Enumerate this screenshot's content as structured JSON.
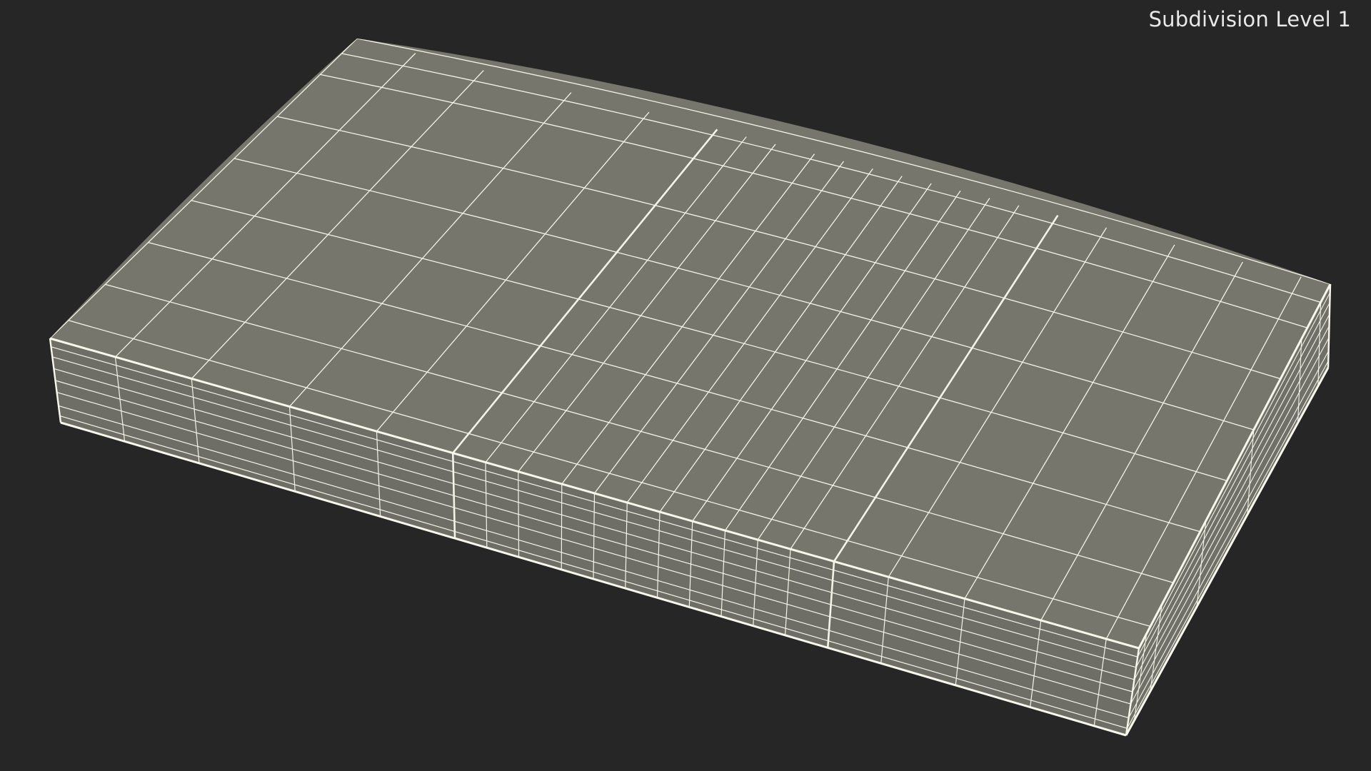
{
  "viewport": {
    "subdivision_label": "Subdivision Level 1"
  },
  "scene": {
    "object": "wireframe-slab",
    "colors": {
      "background": "#262626",
      "top_face": "#76766c",
      "side_face": "#6e6e66",
      "wire": "#f3f3e6"
    }
  }
}
